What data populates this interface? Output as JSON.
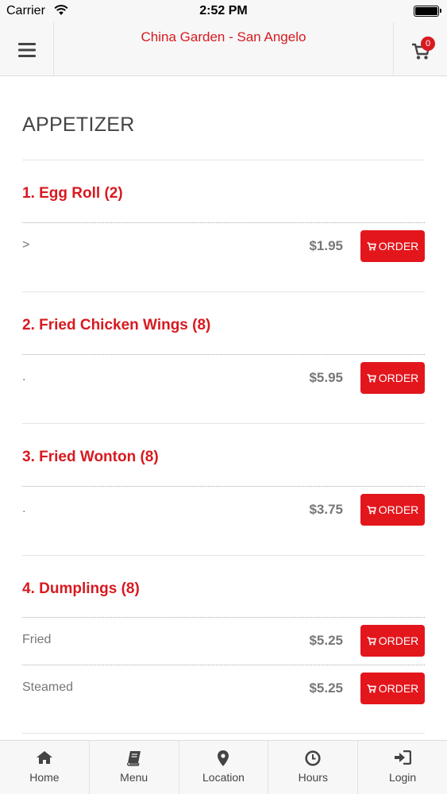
{
  "status_bar": {
    "carrier": "Carrier",
    "time": "2:52 PM"
  },
  "header": {
    "title": "China Garden - San Angelo",
    "cart_count": "0",
    "brand_color": "#d71a20"
  },
  "section": {
    "title": "APPETIZER"
  },
  "items": [
    {
      "name": "1. Egg Roll (2)",
      "variants": [
        {
          "label": ">",
          "price": "$1.95",
          "button": "ORDER"
        }
      ]
    },
    {
      "name": "2. Fried Chicken Wings (8)",
      "variants": [
        {
          "label": ".",
          "price": "$5.95",
          "button": "ORDER"
        }
      ]
    },
    {
      "name": "3. Fried Wonton (8)",
      "variants": [
        {
          "label": ".",
          "price": "$3.75",
          "button": "ORDER"
        }
      ]
    },
    {
      "name": "4. Dumplings (8)",
      "variants": [
        {
          "label": "Fried",
          "price": "$5.25",
          "button": "ORDER"
        },
        {
          "label": "Steamed",
          "price": "$5.25",
          "button": "ORDER"
        }
      ]
    }
  ],
  "nav": [
    {
      "label": "Home",
      "icon": "home-icon"
    },
    {
      "label": "Menu",
      "icon": "book-icon"
    },
    {
      "label": "Location",
      "icon": "map-pin-icon"
    },
    {
      "label": "Hours",
      "icon": "clock-icon"
    },
    {
      "label": "Login",
      "icon": "login-icon"
    }
  ]
}
